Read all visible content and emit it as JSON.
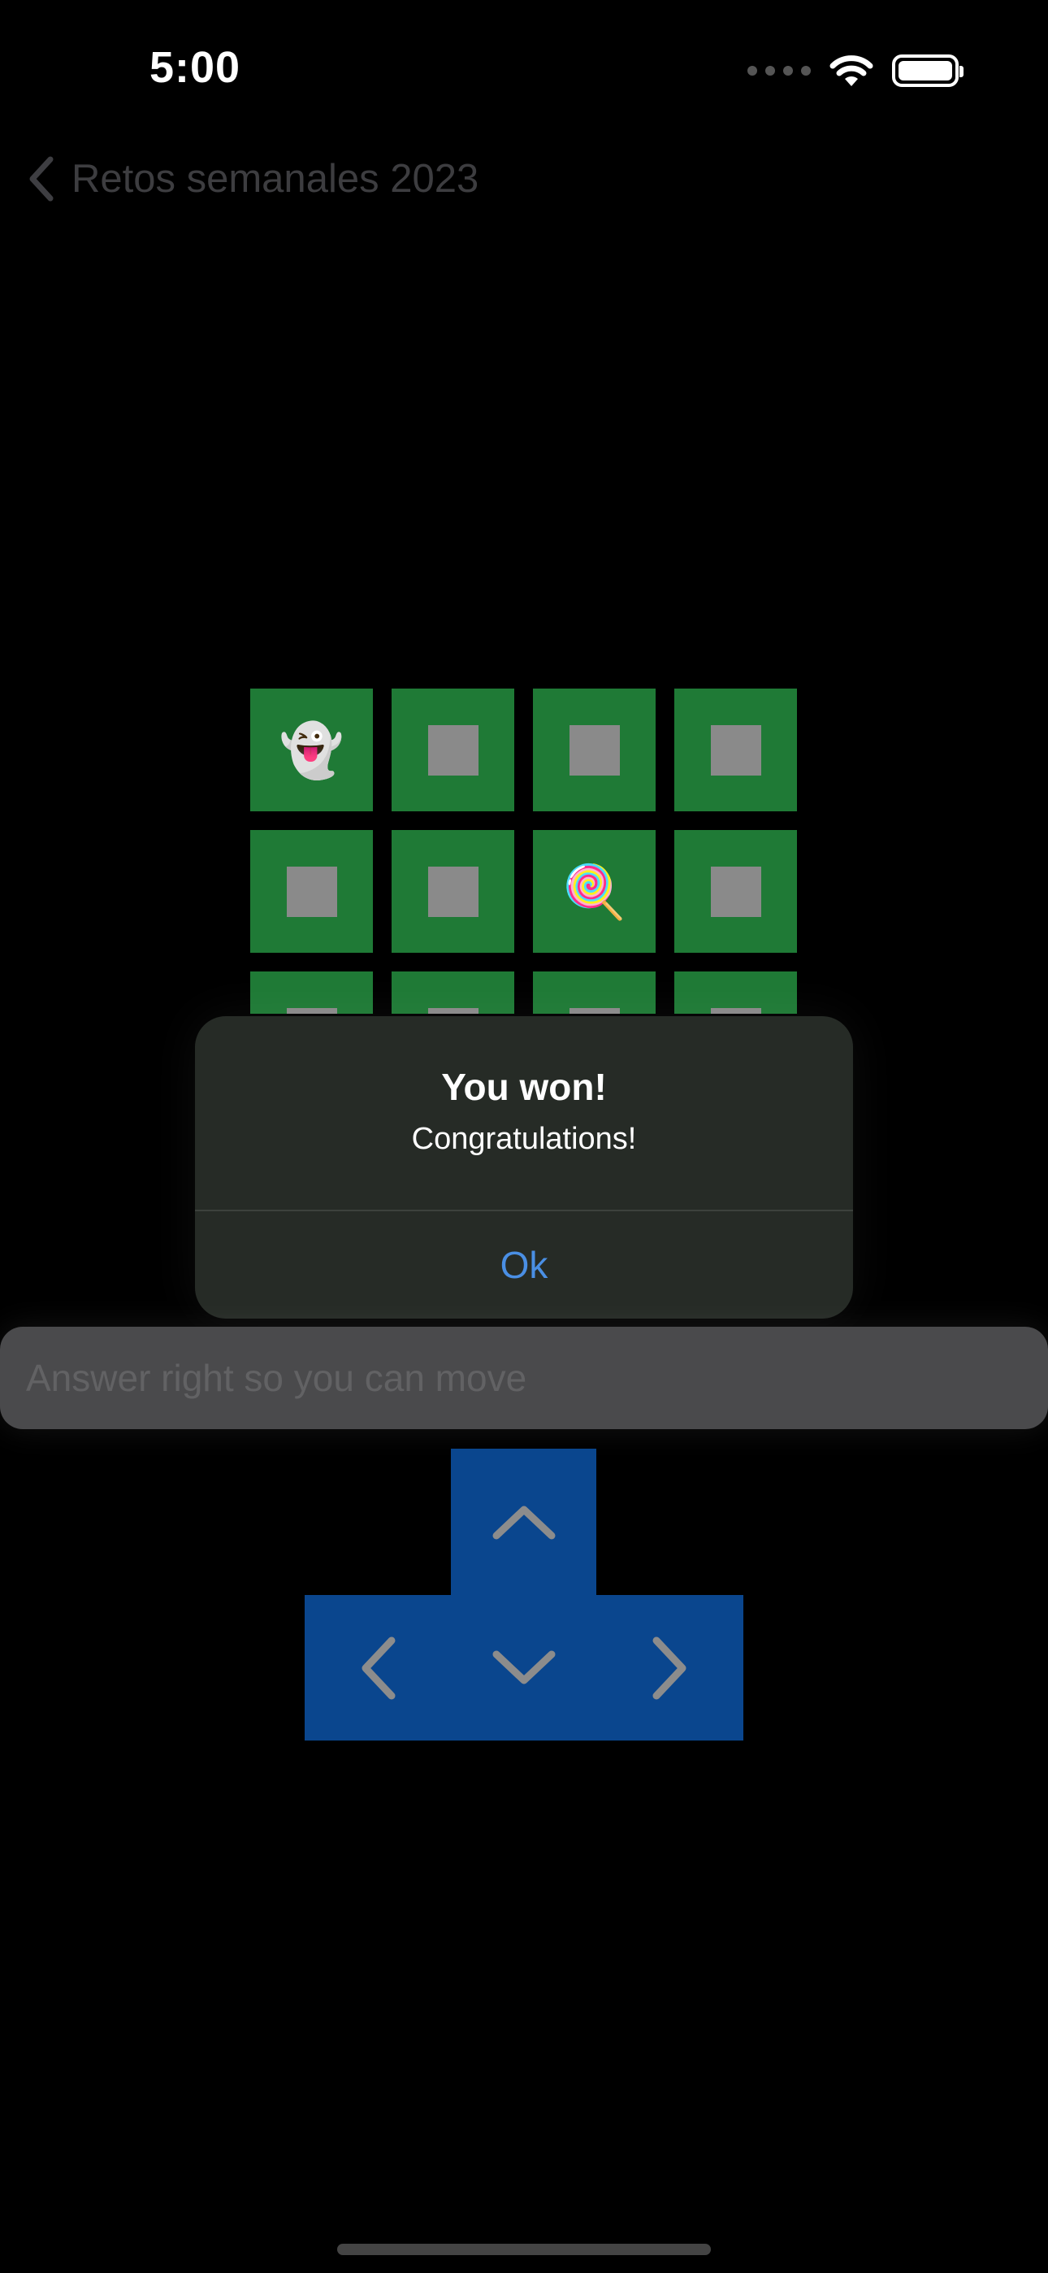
{
  "status_bar": {
    "time": "5:00"
  },
  "nav": {
    "back_title": "Retos semanales 2023"
  },
  "board": {
    "rows": [
      [
        "ghost",
        "empty",
        "empty",
        "empty"
      ],
      [
        "empty",
        "empty",
        "lollipop",
        "empty"
      ],
      [
        "empty",
        "empty",
        "empty",
        "empty"
      ]
    ],
    "tile_color": "#1f7a36",
    "player_glyph": "👻",
    "target_glyph": "🍭"
  },
  "alert": {
    "title": "You won!",
    "message": "Congratulations!",
    "ok_label": "Ok"
  },
  "answer_input": {
    "placeholder": "Answer right so you can move"
  },
  "dpad": {
    "color": "#0a468e"
  }
}
